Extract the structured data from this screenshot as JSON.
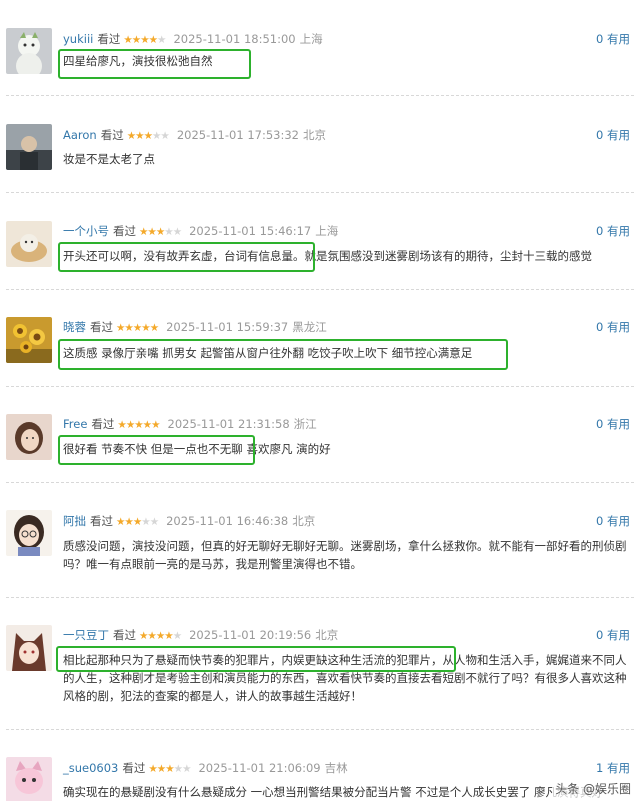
{
  "colors": {
    "link": "#3377aa",
    "star_on": "#f4a92a",
    "star_off": "#d6d6d6",
    "highlight": "#2db12d",
    "meta": "#999999"
  },
  "comments": [
    {
      "username": "yukiii",
      "watched": "看过",
      "rating": 4,
      "time": "2025-11-01 18:51:00",
      "location": "上海",
      "useful": "0 有用",
      "text": "四星给廖凡，演技很松弛自然",
      "avatar": "snowman-avatar"
    },
    {
      "username": "Aaron",
      "watched": "看过",
      "rating": 3,
      "time": "2025-11-01 17:53:32",
      "location": "北京",
      "useful": "0 有用",
      "text": "妆是不是太老了点",
      "avatar": "person-avatar"
    },
    {
      "username": "一个小号",
      "watched": "看过",
      "rating": 3,
      "time": "2025-11-01 15:46:17",
      "location": "上海",
      "useful": "0 有用",
      "text": "开头还可以啊，没有故弄玄虚，台词有信息量。就是氛围感没到迷雾剧场该有的期待，尘封十三载的感觉",
      "avatar": "cat-bread-avatar"
    },
    {
      "username": "晓蓉",
      "watched": "看过",
      "rating": 5,
      "time": "2025-11-01 15:59:37",
      "location": "黑龙江",
      "useful": "0 有用",
      "text": "这质感 录像厅亲嘴 抓男女 起警笛从窗户往外翻 吃饺子吹上吹下 细节控心满意足",
      "avatar": "sunflowers-avatar"
    },
    {
      "username": "Free",
      "watched": "看过",
      "rating": 5,
      "time": "2025-11-01 21:31:58",
      "location": "浙江",
      "useful": "0 有用",
      "text": "很好看 节奏不快 但是一点也不无聊 喜欢廖凡 演的好",
      "avatar": "girl-avatar"
    },
    {
      "username": "阿拙",
      "watched": "看过",
      "rating": 3,
      "time": "2025-11-01 16:46:38",
      "location": "北京",
      "useful": "0 有用",
      "text": "质感没问题，演技没问题，但真的好无聊好无聊好无聊。迷雾剧场，拿什么拯救你。就不能有一部好看的刑侦剧吗？唯一有点眼前一亮的是马苏，我是刑警里演得也不错。",
      "avatar": "glasses-girl-avatar"
    },
    {
      "username": "一只豆丁",
      "watched": "看过",
      "rating": 4,
      "time": "2025-11-01 20:19:56",
      "location": "北京",
      "useful": "0 有用",
      "text": "相比起那种只为了悬疑而快节奏的犯罪片，内娱更缺这种生活流的犯罪片，从人物和生活入手，娓娓道来不同人的人生，这种剧才是考验主创和演员能力的东西，喜欢看快节奏的直接去看短剧不就行了吗？有很多人喜欢这种风格的剧，犯法的查案的都是人，讲人的故事越生活越好！",
      "avatar": "anime-girl-avatar"
    },
    {
      "username": "_sue0603",
      "watched": "看过",
      "rating": 3,
      "time": "2025-11-01 21:06:09",
      "location": "吉林",
      "useful": "1 有用",
      "text": "确实现在的悬疑剧没有什么悬疑成分 一心想当刑警结果被分配当片警 不过是个人成长史罢了 廖凡演得真好",
      "avatar": "pink-cat-avatar"
    }
  ],
  "watermark": "头条 @娱乐圈"
}
